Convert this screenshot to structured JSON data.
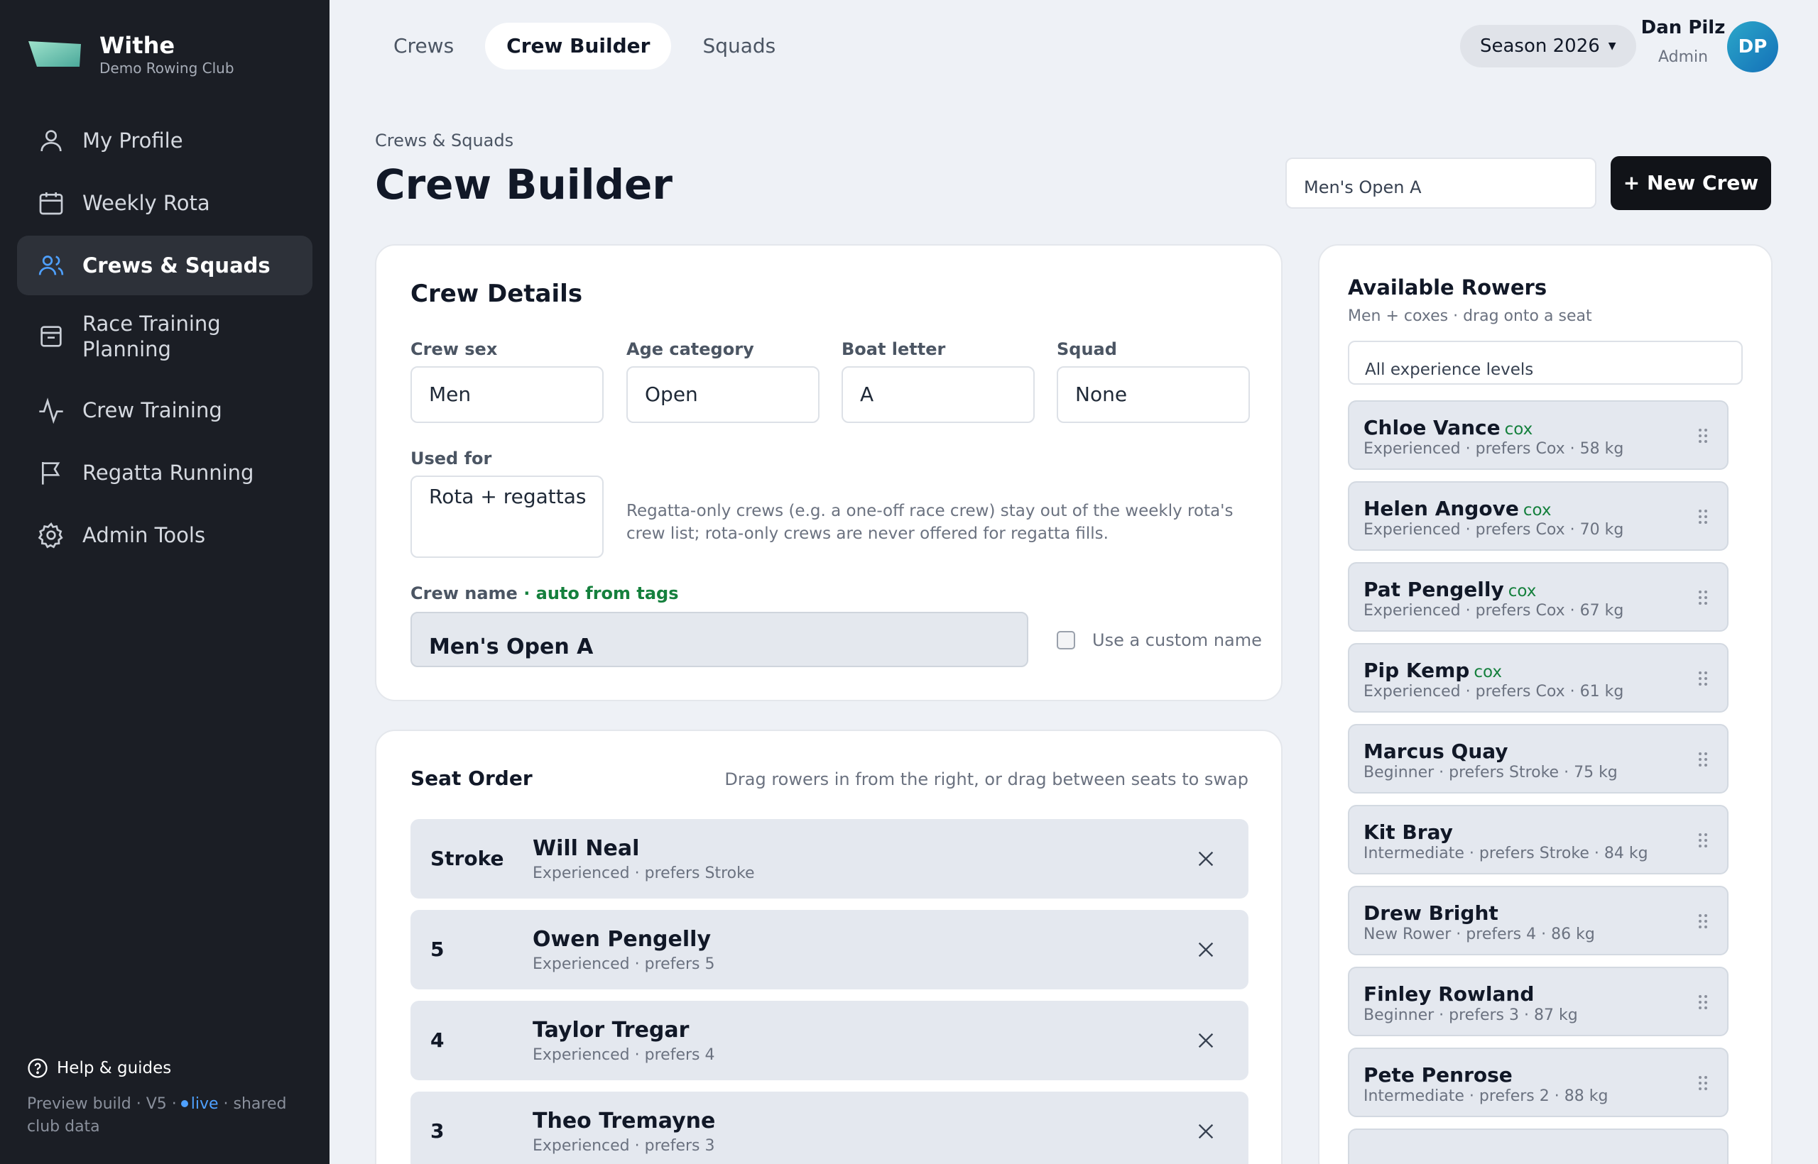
{
  "brand": {
    "name": "Withe",
    "club": "Demo Rowing Club"
  },
  "sidebar": {
    "items": [
      {
        "label": "My Profile",
        "icon": "user-icon"
      },
      {
        "label": "Weekly Rota",
        "icon": "calendar-icon"
      },
      {
        "label": "Crews & Squads",
        "icon": "users-icon",
        "active": true
      },
      {
        "label": "Race Training Planning",
        "icon": "archive-icon"
      },
      {
        "label": "Crew Training",
        "icon": "activity-icon"
      },
      {
        "label": "Regatta Running",
        "icon": "flag-icon"
      },
      {
        "label": "Admin Tools",
        "icon": "gear-icon"
      }
    ],
    "help_label": "Help & guides",
    "build_text": "Preview build · V5 ·",
    "live_label": "live",
    "build_suffix": "· shared club data"
  },
  "topbar": {
    "tabs": [
      "Crews",
      "Crew Builder",
      "Squads"
    ],
    "active_tab": "Crew Builder",
    "season": "Season 2026",
    "user_name": "Dan Pilz",
    "user_role": "Admin",
    "avatar_initials": "DP"
  },
  "header": {
    "breadcrumb": "Crews & Squads",
    "title": "Crew Builder",
    "crew_select_value": "Men's Open A",
    "new_crew_label": "+ New Crew"
  },
  "details": {
    "title": "Crew Details",
    "crew_sex_label": "Crew sex",
    "crew_sex_value": "Men",
    "age_label": "Age category",
    "age_value": "Open",
    "boat_label": "Boat letter",
    "boat_value": "A",
    "squad_label": "Squad",
    "squad_value": "None",
    "used_for_label": "Used for",
    "used_for_value": "Rota + regattas",
    "used_for_hint": "Regatta-only crews (e.g. a one-off race crew) stay out of the weekly rota's crew list; rota-only crews are never offered for regatta fills.",
    "crew_name_label": "Crew name",
    "crew_name_auto": "· auto from tags",
    "crew_name_value": "Men's Open A",
    "custom_name_label": "Use a custom name"
  },
  "seats": {
    "title": "Seat Order",
    "hint": "Drag rowers in from the right, or drag between seats to swap",
    "rows": [
      {
        "seat": "Stroke",
        "name": "Will Neal",
        "meta": "Experienced · prefers Stroke"
      },
      {
        "seat": "5",
        "name": "Owen Pengelly",
        "meta": "Experienced · prefers 5"
      },
      {
        "seat": "4",
        "name": "Taylor Tregar",
        "meta": "Experienced · prefers 4"
      },
      {
        "seat": "3",
        "name": "Theo Tremayne",
        "meta": "Experienced · prefers 3"
      }
    ]
  },
  "rowers": {
    "title": "Available Rowers",
    "subtitle": "Men + coxes · drag onto a seat",
    "filter_value": "All experience levels",
    "list": [
      {
        "name": "Chloe Vance",
        "tag": "cox",
        "meta": "Experienced · prefers Cox · 58 kg"
      },
      {
        "name": "Helen Angove",
        "tag": "cox",
        "meta": "Experienced · prefers Cox · 70 kg"
      },
      {
        "name": "Pat Pengelly",
        "tag": "cox",
        "meta": "Experienced · prefers Cox · 67 kg"
      },
      {
        "name": "Pip Kemp",
        "tag": "cox",
        "meta": "Experienced · prefers Cox · 61 kg"
      },
      {
        "name": "Marcus Quay",
        "tag": "",
        "meta": "Beginner · prefers Stroke · 75 kg"
      },
      {
        "name": "Kit Bray",
        "tag": "",
        "meta": "Intermediate · prefers Stroke · 84 kg"
      },
      {
        "name": "Drew Bright",
        "tag": "",
        "meta": "New Rower · prefers 4 · 86 kg"
      },
      {
        "name": "Finley Rowland",
        "tag": "",
        "meta": "Beginner · prefers 3 · 87 kg"
      },
      {
        "name": "Pete Penrose",
        "tag": "",
        "meta": "Intermediate · prefers 2 · 88 kg"
      }
    ]
  },
  "colors": {
    "sidebar_bg": "#1b1e25",
    "accent_green": "#15803d",
    "live_blue": "#4ea0ff",
    "primary_button": "#111318"
  }
}
